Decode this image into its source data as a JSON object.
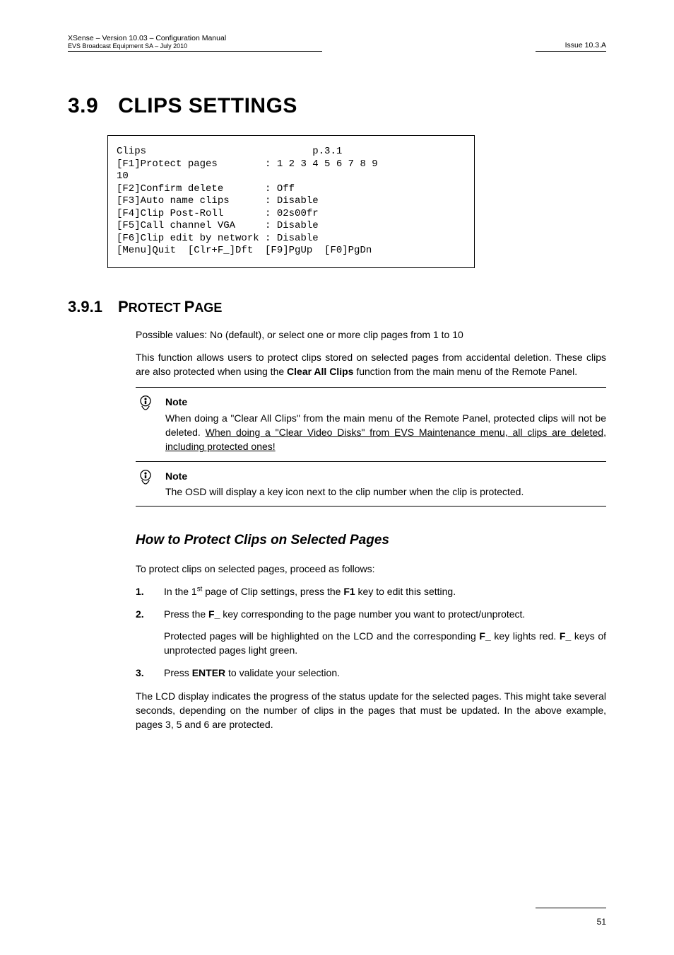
{
  "header": {
    "left_line1": "XSense – Version 10.03 – Configuration Manual",
    "left_line2": "EVS Broadcast Equipment SA – July  2010",
    "right": "Issue 10.3.A"
  },
  "section": {
    "number": "3.9",
    "title": "CLIPS SETTINGS"
  },
  "terminal": "Clips                            p.3.1\n[F1]Protect pages        : 1 2 3 4 5 6 7 8 9\n10\n[F2]Confirm delete       : Off\n[F3]Auto name clips      : Disable\n[F4]Clip Post-Roll       : 02s00fr\n[F5]Call channel VGA     : Disable\n[F6]Clip edit by network : Disable\n[Menu]Quit  [Clr+F_]Dft  [F9]PgUp  [F0]PgDn",
  "subsection": {
    "number": "3.9.1",
    "first1": "P",
    "rest1": "ROTECT ",
    "first2": "P",
    "rest2": "AGE"
  },
  "para1": "Possible values: No (default), or select one or more clip pages from 1 to 10",
  "para2a": "This function allows users to protect clips stored on selected pages from accidental deletion. These clips are also protected when using the ",
  "para2b": "Clear All Clips",
  "para2c": " function from the main menu of the Remote Panel.",
  "note1": {
    "label": "Note",
    "text_a": "When doing a \"Clear All Clips\" from the main menu of the Remote Panel, protected clips will not be deleted. ",
    "text_u": "When doing a \"Clear Video Disks\" from EVS Maintenance menu, all clips are deleted, including protected ones!"
  },
  "note2": {
    "label": "Note",
    "text": "The OSD will display a key icon next to the clip number when the clip is protected."
  },
  "howto": "How to Protect Clips on Selected Pages",
  "intro": "To protect clips on selected pages, proceed as follows:",
  "steps": {
    "s1": {
      "marker": "1.",
      "a": "In the 1",
      "sup": "st",
      "b": " page of Clip settings, press the ",
      "key": "F1",
      "c": " key to edit this setting."
    },
    "s2": {
      "marker": "2.",
      "p1a": "Press the ",
      "p1key": "F_",
      "p1b": " key corresponding to the page number you want to protect/unprotect.",
      "p2a": "Protected pages will be highlighted on the LCD and the corresponding ",
      "p2key1": "F_",
      "p2b": " key lights red. ",
      "p2key2": "F_",
      "p2c": " keys of unprotected pages light green."
    },
    "s3": {
      "marker": "3.",
      "a": "Press ",
      "key": "ENTER",
      "b": " to validate your selection."
    }
  },
  "closing": "The LCD display indicates the progress of the status update for the selected pages. This might take several seconds, depending on the number of clips in the pages that must be updated. In the above example, pages 3, 5 and 6 are protected.",
  "footer": {
    "page": "51"
  }
}
